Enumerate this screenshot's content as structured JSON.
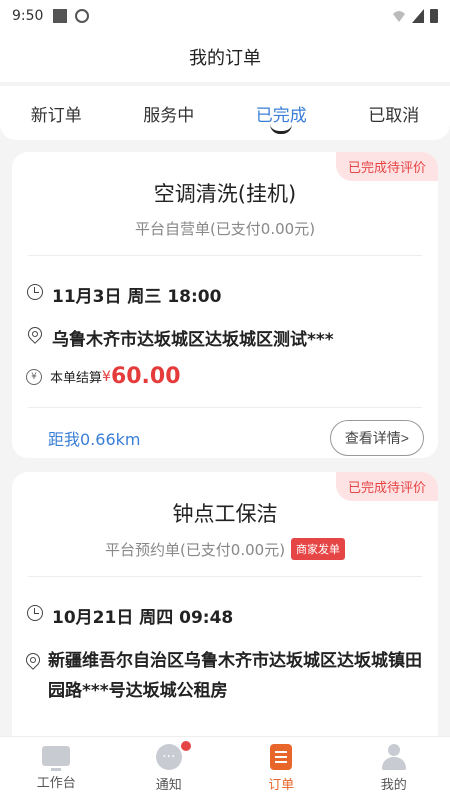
{
  "status_bar": {
    "time": "9:50"
  },
  "header": {
    "title": "我的订单"
  },
  "tabs": [
    {
      "label": "新订单",
      "active": false
    },
    {
      "label": "服务中",
      "active": false
    },
    {
      "label": "已完成",
      "active": true
    },
    {
      "label": "已取消",
      "active": false
    }
  ],
  "orders": [
    {
      "badge": "已完成待评价",
      "title": "空调清洗(挂机)",
      "subtitle": "平台自营单(已支付0.00元)",
      "time": "11月3日 周三 18:00",
      "address": "乌鲁木齐市达坂城区达坂城区测试***",
      "settle_label": "本单结算",
      "currency": "¥",
      "amount": "60.00",
      "distance": "距我0.66km",
      "detail_label": "查看详情>"
    },
    {
      "badge": "已完成待评价",
      "title": "钟点工保洁",
      "subtitle": "平台预约单(已支付0.00元)",
      "tag": "商家发单",
      "time": "10月21日 周四 09:48",
      "address": "新疆维吾尔自治区乌鲁木齐市达坂城区达坂城镇田园路***号达坂城公租房"
    }
  ],
  "nav": [
    {
      "label": "工作台",
      "icon": "workbench-icon"
    },
    {
      "label": "通知",
      "icon": "notification-icon"
    },
    {
      "label": "订单",
      "icon": "order-icon",
      "active": true
    },
    {
      "label": "我的",
      "icon": "profile-icon"
    }
  ],
  "colors": {
    "accent": "#3a7fd7",
    "price": "#e53b3b",
    "nav_active": "#e8662a",
    "badge_bg": "#fde3e3"
  }
}
